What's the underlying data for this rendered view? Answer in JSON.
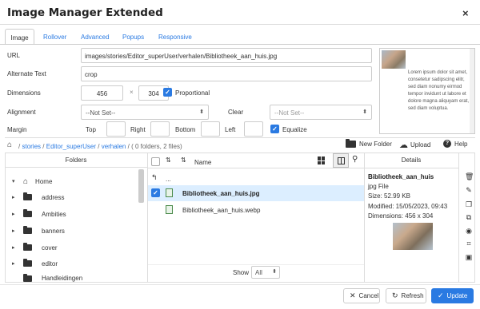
{
  "dialog": {
    "title": "Image Manager Extended",
    "close": "×"
  },
  "tabs": [
    {
      "label": "Image"
    },
    {
      "label": "Rollover"
    },
    {
      "label": "Advanced"
    },
    {
      "label": "Popups"
    },
    {
      "label": "Responsive"
    }
  ],
  "form": {
    "url_label": "URL",
    "url_value": "images/stories/Editor_superUser/verhalen/Bibliotheek_aan_huis.jpg",
    "alt_label": "Alternate Text",
    "alt_value": "crop",
    "dimensions_label": "Dimensions",
    "width": "456",
    "times": "×",
    "height": "304",
    "proportional": "Proportional",
    "alignment_label": "Alignment",
    "alignment_value": "--Not Set--",
    "clear_label": "Clear",
    "clear_value": "--Not Set--",
    "margin_label": "Margin",
    "top": "Top",
    "right": "Right",
    "bottom": "Bottom",
    "left": "Left",
    "equalize": "Equalize"
  },
  "preview_text": "Lorem ipsum dolor sit amet, consetetur sadipscing elitr, sed diam nonumy eirmod tempor invidunt ut labore et dolore magna aliquyam erat, sed diam voluptua.",
  "breadcrumb": {
    "sep": "/",
    "stories": "stories",
    "editor": "Editor_superUser",
    "verhalen": "verhalen",
    "count": "( 0 folders, 2 files)"
  },
  "toolbar": {
    "new_folder": "New Folder",
    "upload": "Upload",
    "help": "Help"
  },
  "folders": {
    "header": "Folders",
    "items": [
      {
        "label": "Home"
      },
      {
        "label": "address"
      },
      {
        "label": "Ambities"
      },
      {
        "label": "banners"
      },
      {
        "label": "cover"
      },
      {
        "label": "editor"
      },
      {
        "label": "Handleidingen"
      }
    ]
  },
  "files": {
    "name_header": "Name",
    "up": "...",
    "items": [
      {
        "name": "Bibliotheek_aan_huis.jpg",
        "selected": true
      },
      {
        "name": "Bibliotheek_aan_huis.webp",
        "selected": false
      }
    ],
    "show_label": "Show",
    "show_value": "All"
  },
  "details": {
    "header": "Details",
    "name": "Bibliotheek_aan_huis",
    "type": "jpg File",
    "size": "Size: 52.99 KB",
    "modified": "Modified: 15/05/2023, 09:43",
    "dimensions": "Dimensions: 456 x 304"
  },
  "footer": {
    "cancel": "Cancel",
    "refresh": "Refresh",
    "update": "Update"
  },
  "colors": {
    "accent": "#2a7ae2",
    "selected_row": "#dceeff"
  }
}
